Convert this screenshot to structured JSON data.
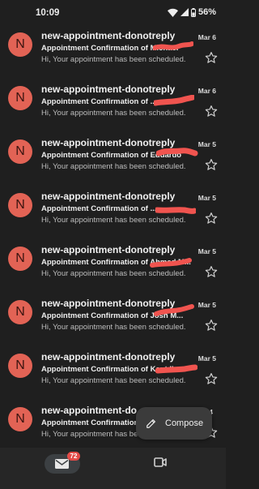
{
  "status_bar": {
    "time": "10:09",
    "battery": "56%"
  },
  "emails": [
    {
      "avatar": "N",
      "sender": "new-appointment-donotreply",
      "date": "Mar 6",
      "subject": "Appointment Confirmation of Michael",
      "snippet": "Hi, Your appointment has been scheduled."
    },
    {
      "avatar": "N",
      "sender": "new-appointment-donotreply",
      "date": "Mar 6",
      "subject": "Appointment Confirmation of ...",
      "snippet": "Hi, Your appointment has been scheduled."
    },
    {
      "avatar": "N",
      "sender": "new-appointment-donotreply",
      "date": "Mar 5",
      "subject": "Appointment Confirmation of Eduardo",
      "snippet": "Hi, Your appointment has been scheduled."
    },
    {
      "avatar": "N",
      "sender": "new-appointment-donotreply",
      "date": "Mar 5",
      "subject": "Appointment Confirmation of ...",
      "snippet": "Hi, Your appointment has been scheduled."
    },
    {
      "avatar": "N",
      "sender": "new-appointment-donotreply",
      "date": "Mar 5",
      "subject": "Appointment Confirmation of Ahmed M...",
      "snippet": "Hi, Your appointment has been scheduled."
    },
    {
      "avatar": "N",
      "sender": "new-appointment-donotreply",
      "date": "Mar 5",
      "subject": "Appointment Confirmation of Josh M...",
      "snippet": "Hi, Your appointment has been scheduled."
    },
    {
      "avatar": "N",
      "sender": "new-appointment-donotreply",
      "date": "Mar 5",
      "subject": "Appointment Confirmation of Kent Ilm...",
      "snippet": "Hi, Your appointment has been scheduled."
    },
    {
      "avatar": "N",
      "sender": "new-appointment-do",
      "date": "4",
      "subject": "Appointment Confirmation of",
      "snippet": "Hi, Your appointment has been schedule..."
    }
  ],
  "compose": {
    "label": "Compose"
  },
  "bottom_nav": {
    "mail_badge": "72",
    "mail_icon": "mail-icon",
    "meet_icon": "video-camera-icon"
  },
  "colors": {
    "background": "#1f1f1f",
    "avatar": "#e26355",
    "badge": "#e44b47",
    "redaction": "#f0544f"
  }
}
